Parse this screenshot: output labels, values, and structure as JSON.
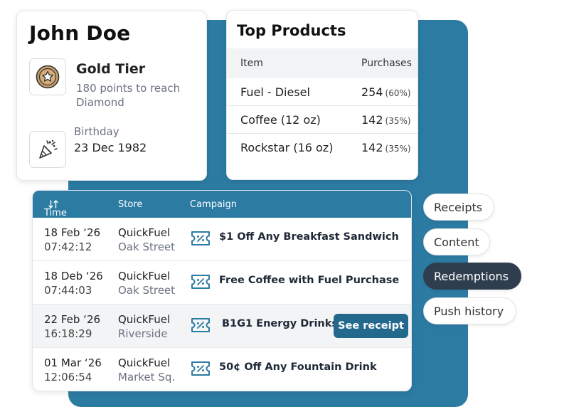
{
  "profile": {
    "name": "John Doe",
    "tier_icon": "star-badge-icon",
    "tier_title": "Gold Tier",
    "tier_progress": "180 points to reach Diamond",
    "birthday_icon": "party-popper-icon",
    "birthday_label": "Birthday",
    "birthday_value": "23 Dec 1982"
  },
  "top_products": {
    "title": "Top Products",
    "headers": {
      "item": "Item",
      "purchases": "Purchases"
    },
    "rows": [
      {
        "item": "Fuel - Diesel",
        "count": "254",
        "percent": "(60%)"
      },
      {
        "item": "Coffee (12 oz)",
        "count": "142",
        "percent": "(35%)"
      },
      {
        "item": "Rockstar (16 oz)",
        "count": "142",
        "percent": "(35%)"
      }
    ]
  },
  "redemptions": {
    "headers": {
      "time": "Time",
      "store": "Store",
      "campaign": "Campaign"
    },
    "sort_icon": "sort-arrows-icon",
    "coupon_icon": "coupon-icon",
    "rows": [
      {
        "date": "18 Feb ‘26",
        "time": "07:42:12",
        "store": "QuickFuel",
        "location": "Oak Street",
        "campaign": "$1 Off Any Breakfast Sandwich"
      },
      {
        "date": "18 Deb ‘26",
        "time": "07:44:03",
        "store": "QuickFuel",
        "location": "Oak Street",
        "campaign": "Free Coffee with Fuel Purchase"
      },
      {
        "date": "22 Feb ‘26",
        "time": "16:18:29",
        "store": "QuickFuel",
        "location": "Riverside",
        "campaign": "B1G1 Energy Drinks",
        "action": "See receipt"
      },
      {
        "date": "01 Mar ‘26",
        "time": "12:06:54",
        "store": "QuickFuel",
        "location": "Market Sq.",
        "campaign": "50¢ Off Any Fountain Drink"
      }
    ]
  },
  "tabs": [
    {
      "label": "Receipts",
      "active": false
    },
    {
      "label": "Content",
      "active": false
    },
    {
      "label": "Redemptions",
      "active": true
    },
    {
      "label": "Push history",
      "active": false
    }
  ],
  "colors": {
    "accent": "#2c7ba3",
    "button": "#23698e",
    "active_tab": "#2e3e4f",
    "gold": "#c9a06b"
  }
}
